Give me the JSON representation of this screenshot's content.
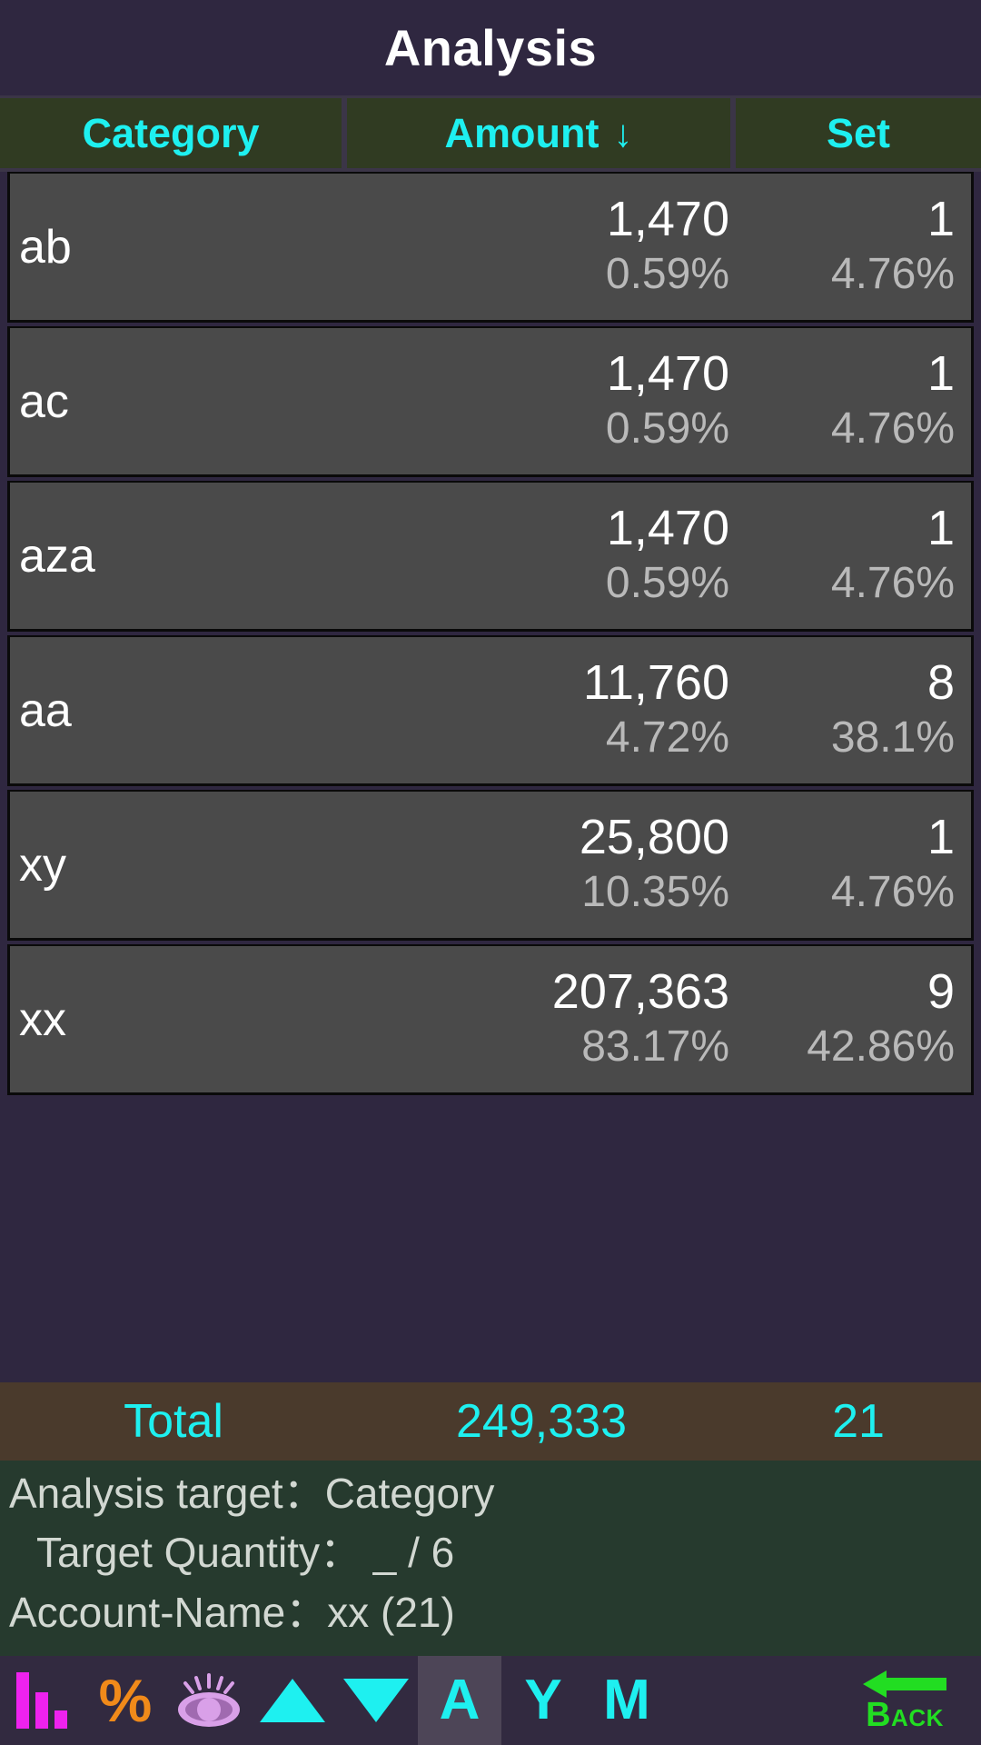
{
  "header": {
    "title": "Analysis"
  },
  "table": {
    "columns": [
      {
        "key": "category",
        "label": "Category",
        "sort_arrow": ""
      },
      {
        "key": "amount",
        "label": "Amount",
        "sort_arrow": "↓"
      },
      {
        "key": "set",
        "label": "Set",
        "sort_arrow": ""
      }
    ],
    "rows": [
      {
        "category": "ab",
        "amount": "1,470",
        "amount_pct": "0.59%",
        "set": "1",
        "set_pct": "4.76%"
      },
      {
        "category": "ac",
        "amount": "1,470",
        "amount_pct": "0.59%",
        "set": "1",
        "set_pct": "4.76%"
      },
      {
        "category": "aza",
        "amount": "1,470",
        "amount_pct": "0.59%",
        "set": "1",
        "set_pct": "4.76%"
      },
      {
        "category": "aa",
        "amount": "11,760",
        "amount_pct": "4.72%",
        "set": "8",
        "set_pct": "38.1%"
      },
      {
        "category": "xy",
        "amount": "25,800",
        "amount_pct": "10.35%",
        "set": "1",
        "set_pct": "4.76%"
      },
      {
        "category": "xx",
        "amount": "207,363",
        "amount_pct": "83.17%",
        "set": "9",
        "set_pct": "42.86%"
      }
    ],
    "total": {
      "label": "Total",
      "amount": "249,333",
      "set": "21"
    }
  },
  "info": {
    "analysis_target": "Analysis target：Category",
    "target_quantity": "Target Quantity： _  / 6",
    "account_name": "Account-Name：xx  (21)"
  },
  "toolbar": {
    "items": [
      {
        "name": "bar-chart-icon",
        "kind": "bars",
        "label": "",
        "selected": false
      },
      {
        "name": "percent-icon",
        "kind": "pct",
        "label": "%",
        "selected": false
      },
      {
        "name": "eye-icon",
        "kind": "eye",
        "label": "",
        "selected": false
      },
      {
        "name": "triangle-up-icon",
        "kind": "triup",
        "label": "",
        "selected": false
      },
      {
        "name": "triangle-down-icon",
        "kind": "tridown",
        "label": "",
        "selected": false
      },
      {
        "name": "all-period-button",
        "kind": "letter",
        "label": "A",
        "selected": true
      },
      {
        "name": "year-period-button",
        "kind": "letter",
        "label": "Y",
        "selected": false
      },
      {
        "name": "month-period-button",
        "kind": "letter",
        "label": "M",
        "selected": false
      }
    ],
    "back": {
      "cap": "B",
      "rest": "ACK"
    }
  },
  "colors": {
    "accent_cyan": "#1ef0f0",
    "title_bg": "#2f2740",
    "header_cell_bg": "#303b22",
    "row_bg": "#4a4a4a",
    "total_bg": "#4a3a2c",
    "info_bg": "#263a2e",
    "toolbar_bg": "#322a40",
    "magenta": "#ee22ee",
    "orange": "#f08a1a",
    "eye_pink": "#d9a0e8",
    "green": "#22dd22"
  },
  "chart_data": {
    "type": "table",
    "title": "Analysis",
    "categories": [
      "ab",
      "ac",
      "aza",
      "aa",
      "xy",
      "xx"
    ],
    "series": [
      {
        "name": "Amount",
        "values": [
          1470,
          1470,
          1470,
          11760,
          25800,
          207363
        ]
      },
      {
        "name": "Amount %",
        "values": [
          0.59,
          0.59,
          0.59,
          4.72,
          10.35,
          83.17
        ]
      },
      {
        "name": "Set",
        "values": [
          1,
          1,
          1,
          8,
          1,
          9
        ]
      },
      {
        "name": "Set %",
        "values": [
          4.76,
          4.76,
          4.76,
          38.1,
          4.76,
          42.86
        ]
      }
    ],
    "totals": {
      "Amount": 249333,
      "Set": 21
    },
    "sorted_by": "Amount",
    "sort_direction": "ascending",
    "xlabel": "Category",
    "ylabel": "Amount"
  }
}
